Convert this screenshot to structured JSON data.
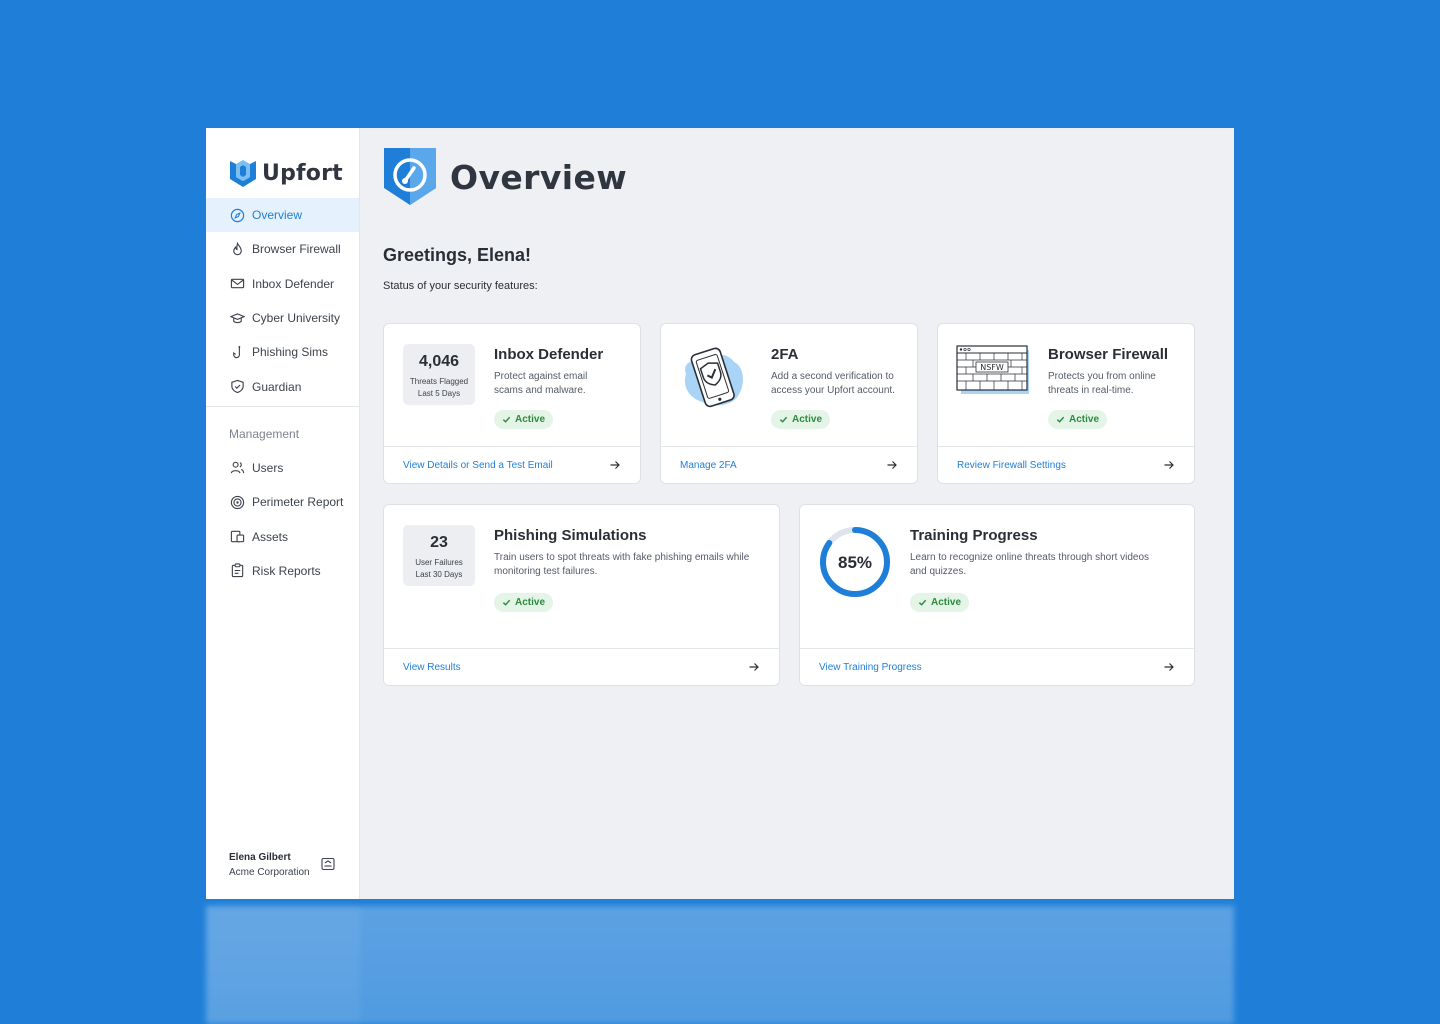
{
  "app": {
    "brand": "Upfort",
    "accent": "#1f7fd8"
  },
  "sidebar": {
    "items": [
      {
        "label": "Overview",
        "icon": "compass-icon",
        "active": true
      },
      {
        "label": "Browser Firewall",
        "icon": "flame-icon"
      },
      {
        "label": "Inbox Defender",
        "icon": "envelope-icon"
      },
      {
        "label": "Cyber University",
        "icon": "graduation-cap-icon"
      },
      {
        "label": "Phishing Sims",
        "icon": "fishhook-icon"
      },
      {
        "label": "Guardian",
        "icon": "shield-check-icon"
      }
    ],
    "section_label": "Management",
    "management_items": [
      {
        "label": "Users",
        "icon": "users-icon"
      },
      {
        "label": "Perimeter Report",
        "icon": "target-icon"
      },
      {
        "label": "Assets",
        "icon": "assets-icon"
      },
      {
        "label": "Risk Reports",
        "icon": "clipboard-icon"
      }
    ],
    "user": {
      "name": "Elena Gilbert",
      "org": "Acme Corporation"
    }
  },
  "header": {
    "title": "Overview"
  },
  "main": {
    "greeting": "Greetings, Elena!",
    "subtext": "Status of your security features:"
  },
  "cards": {
    "inbox": {
      "stat_value": "4,046",
      "stat_label_1": "Threats Flagged",
      "stat_label_2": "Last 5 Days",
      "title": "Inbox Defender",
      "desc_1": "Protect against email",
      "desc_2": "scams and malware.",
      "status": "Active",
      "link": "View Details or Send a Test Email"
    },
    "twofa": {
      "title": "2FA",
      "desc_1": "Add a second verification to",
      "desc_2": "access your Upfort account.",
      "status": "Active",
      "link": "Manage 2FA"
    },
    "firewall": {
      "illus_text": "NSFW",
      "title": "Browser Firewall",
      "desc_1": "Protects you from online",
      "desc_2": "threats in real-time.",
      "status": "Active",
      "link": "Review Firewall Settings"
    },
    "phishing": {
      "stat_value": "23",
      "stat_label_1": "User  Failures",
      "stat_label_2": "Last 30 Days",
      "title": "Phishing Simulations",
      "desc_1": "Train users to spot threats with fake phishing emails while",
      "desc_2": "monitoring test failures.",
      "status": "Active",
      "link": "View Results"
    },
    "training": {
      "progress_label": "85%",
      "progress": 0.85,
      "title": "Training Progress",
      "desc_1": "Learn to recognize online threats through short videos",
      "desc_2": "and quizzes.",
      "status": "Active",
      "link": "View Training Progress"
    }
  }
}
